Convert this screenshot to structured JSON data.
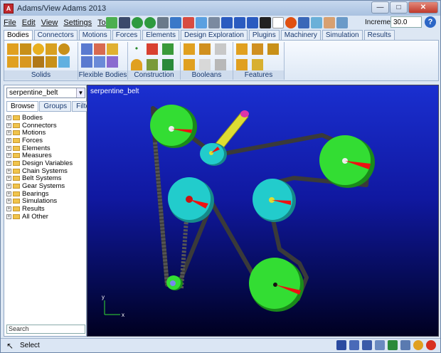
{
  "window": {
    "title": "Adams/View Adams 2013",
    "minimize": "—",
    "maximize": "□",
    "close": "✕"
  },
  "menu": [
    "File",
    "Edit",
    "View",
    "Settings",
    "Tools"
  ],
  "toolbar": {
    "increment_label": "Increment",
    "increment_value": "30.0",
    "help": "?"
  },
  "ribbon_tabs": [
    "Bodies",
    "Connectors",
    "Motions",
    "Forces",
    "Elements",
    "Design Exploration",
    "Plugins",
    "Machinery",
    "Simulation",
    "Results"
  ],
  "ribbon_groups": [
    "Solids",
    "Flexible Bodies",
    "Construction",
    "Booleans",
    "Features"
  ],
  "left_panel": {
    "model": "serpentine_belt",
    "tabs": [
      "Browse",
      "Groups",
      "Filters"
    ],
    "tree": [
      "Bodies",
      "Connectors",
      "Motions",
      "Forces",
      "Elements",
      "Measures",
      "Design Variables",
      "Chain Systems",
      "Belt Systems",
      "Gear Systems",
      "Bearings",
      "Simulations",
      "Results",
      "All Other"
    ],
    "search_placeholder": "Search"
  },
  "viewport": {
    "model_name": "serpentine_belt",
    "axis_x": "x",
    "axis_y": "y"
  },
  "status": {
    "text": "Select"
  },
  "colors": {
    "pulley_green": "#33dd33",
    "pulley_cyan": "#22cccc",
    "belt": "#3a3a3a",
    "arm": "#dddd33",
    "marker": "#ee1111"
  }
}
